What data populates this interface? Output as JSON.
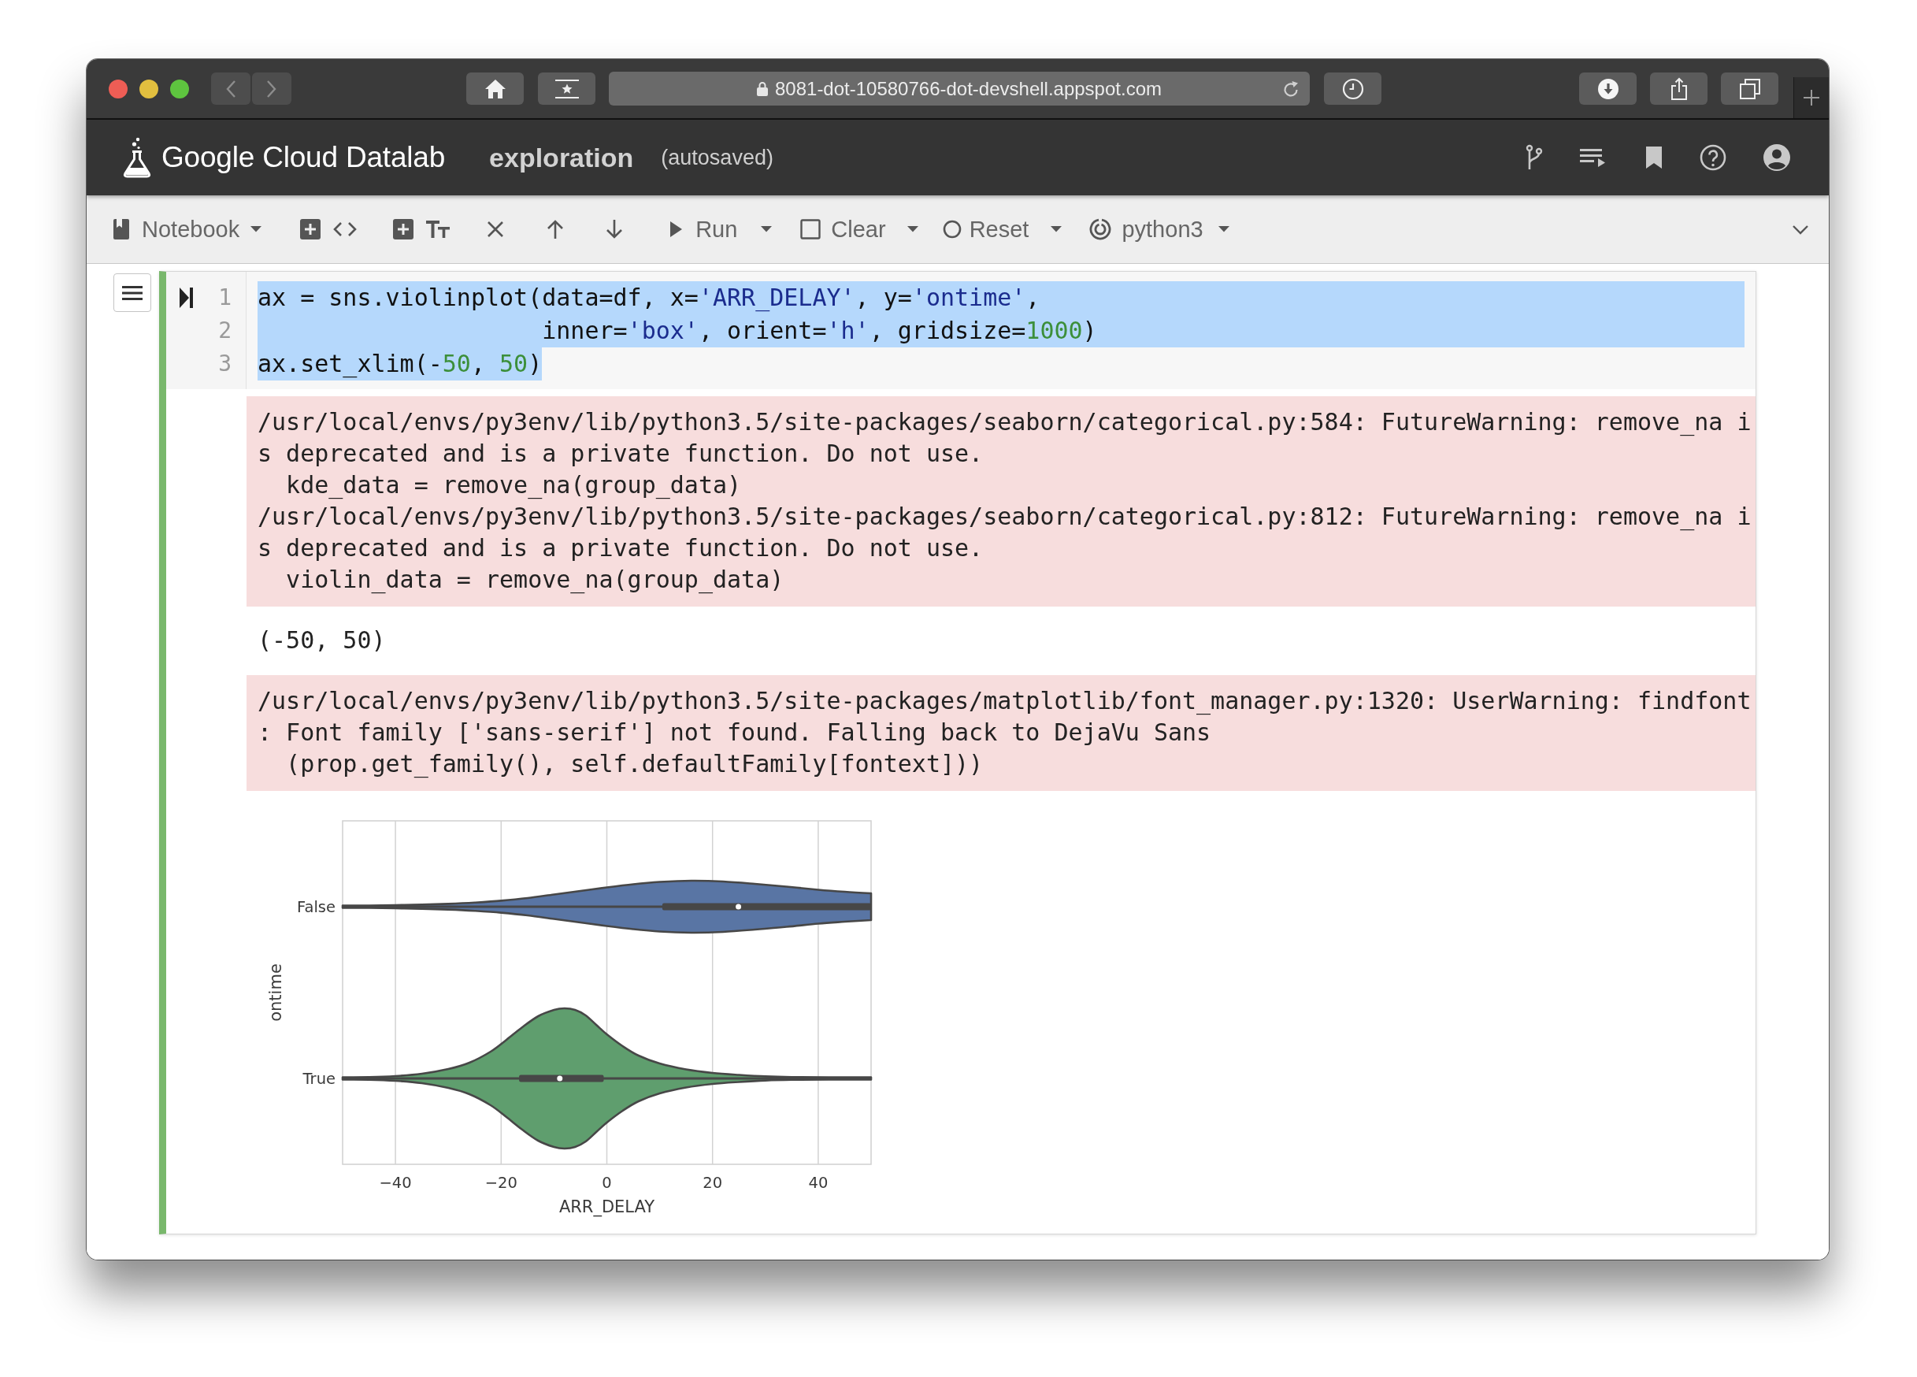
{
  "browser": {
    "url": "8081-dot-10580766-dot-devshell.appspot.com"
  },
  "header": {
    "brand": "Google Cloud Datalab",
    "notebook_name": "exploration",
    "save_status": "(autosaved)"
  },
  "toolbar": {
    "items": [
      {
        "kind": "menu",
        "label": "Notebook"
      },
      {
        "kind": "add_code"
      },
      {
        "kind": "add_text"
      },
      {
        "kind": "delete"
      },
      {
        "kind": "move_up"
      },
      {
        "kind": "move_down"
      },
      {
        "kind": "run",
        "label": "Run"
      },
      {
        "kind": "clear",
        "label": "Clear"
      },
      {
        "kind": "reset",
        "label": "Reset"
      },
      {
        "kind": "kernel",
        "label": "python3"
      }
    ]
  },
  "cell": {
    "selected": true,
    "lines": [
      {
        "number": "1",
        "selected": true,
        "tokens": [
          {
            "kind": "plain",
            "text": "ax = sns.violinplot(data=df, x="
          },
          {
            "kind": "string",
            "text": "'ARR_DELAY'"
          },
          {
            "kind": "plain",
            "text": ", y="
          },
          {
            "kind": "string",
            "text": "'ontime'"
          },
          {
            "kind": "plain",
            "text": ","
          }
        ]
      },
      {
        "number": "2",
        "selected": true,
        "tokens": [
          {
            "kind": "plain",
            "text": "                    inner="
          },
          {
            "kind": "string",
            "text": "'box'"
          },
          {
            "kind": "plain",
            "text": ", orient="
          },
          {
            "kind": "string",
            "text": "'h'"
          },
          {
            "kind": "plain",
            "text": ", gridsize="
          },
          {
            "kind": "number",
            "text": "1000"
          },
          {
            "kind": "plain",
            "text": ")"
          }
        ]
      },
      {
        "number": "3",
        "selected": true,
        "tokens": [
          {
            "kind": "plain",
            "text": "ax.set_xlim(-"
          },
          {
            "kind": "number",
            "text": "50"
          },
          {
            "kind": "plain",
            "text": ", "
          },
          {
            "kind": "number",
            "text": "50"
          },
          {
            "kind": "plain",
            "text": ")"
          }
        ]
      }
    ],
    "outputs": [
      {
        "kind": "stderr",
        "lines": [
          "/usr/local/envs/py3env/lib/python3.5/site-packages/seaborn/categorical.py:584: FutureWarning: remove_na i",
          "s deprecated and is a private function. Do not use.",
          "  kde_data = remove_na(group_data)",
          "/usr/local/envs/py3env/lib/python3.5/site-packages/seaborn/categorical.py:812: FutureWarning: remove_na i",
          "s deprecated and is a private function. Do not use.",
          "  violin_data = remove_na(group_data)"
        ]
      },
      {
        "kind": "result",
        "lines": [
          "(-50, 50)"
        ]
      },
      {
        "kind": "stderr",
        "lines": [
          "/usr/local/envs/py3env/lib/python3.5/site-packages/matplotlib/font_manager.py:1320: UserWarning: findfont",
          ": Font family ['sans-serif'] not found. Falling back to DejaVu Sans",
          "  (prop.get_family(), self.defaultFamily[fontext]))"
        ]
      },
      {
        "kind": "figure",
        "ylabel": "ontime",
        "xlabel": "ARR_DELAY",
        "xtick_labels": [
          "−40",
          "−20",
          "0",
          "20",
          "40"
        ],
        "categories": [
          {
            "label": "False",
            "color": "#5975a4"
          },
          {
            "label": "True",
            "color": "#5f9e6e"
          }
        ]
      }
    ]
  }
}
